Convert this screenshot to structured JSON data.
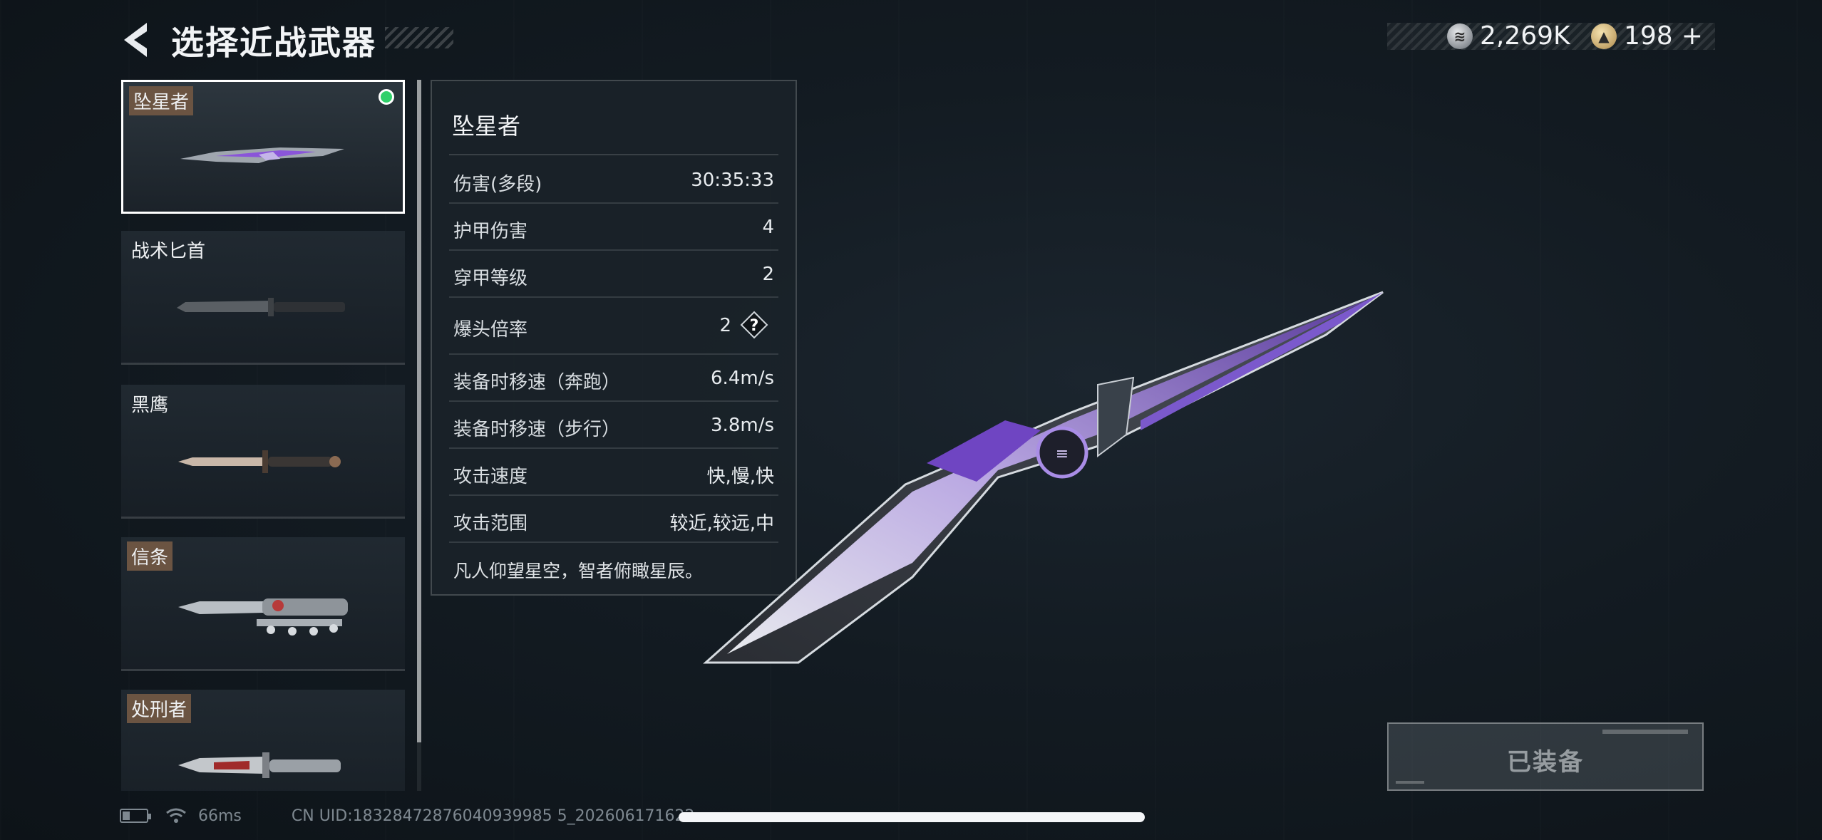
{
  "header": {
    "title": "选择近战武器",
    "back_icon": "chevron-left-icon"
  },
  "currency": {
    "silver": {
      "icon": "silver-coin-icon",
      "amount": "2,269K"
    },
    "gold": {
      "icon": "gold-coin-icon",
      "amount": "198",
      "add_label": "+"
    }
  },
  "weapons": [
    {
      "name": "坠星者",
      "selected": true,
      "equipped": true,
      "tag_style": "highlight"
    },
    {
      "name": "战术匕首",
      "selected": false,
      "equipped": false,
      "tag_style": "plain"
    },
    {
      "name": "黑鹰",
      "selected": false,
      "equipped": false,
      "tag_style": "plain"
    },
    {
      "name": "信条",
      "selected": false,
      "equipped": false,
      "tag_style": "highlight"
    },
    {
      "name": "处刑者",
      "selected": false,
      "equipped": false,
      "tag_style": "highlight"
    }
  ],
  "stats": {
    "title": "坠星者",
    "rows": [
      {
        "label": "伤害(多段)",
        "value": "30:35:33"
      },
      {
        "label": "护甲伤害",
        "value": "4"
      },
      {
        "label": "穿甲等级",
        "value": "2"
      },
      {
        "label": "爆头倍率",
        "value": "2",
        "help_icon": "question-mark-icon",
        "help_text": "?"
      },
      {
        "label": "装备时移速（奔跑）",
        "value": "6.4m/s"
      },
      {
        "label": "装备时移速（步行）",
        "value": "3.8m/s"
      },
      {
        "label": "攻击速度",
        "value": "快,慢,快"
      },
      {
        "label": "攻击范围",
        "value": "较近,较远,中"
      }
    ],
    "description": "凡人仰望星空，智者俯瞰星辰。"
  },
  "equip_button": {
    "label": "已装备",
    "state": "disabled"
  },
  "status_bar": {
    "ping": "66ms",
    "uid": "CN UID:18328472876040939985 5_202606171622"
  },
  "colors": {
    "accent_purple": "#8a55d9",
    "equipped_green": "#31d06a",
    "tag_brown": "#6b5442"
  }
}
